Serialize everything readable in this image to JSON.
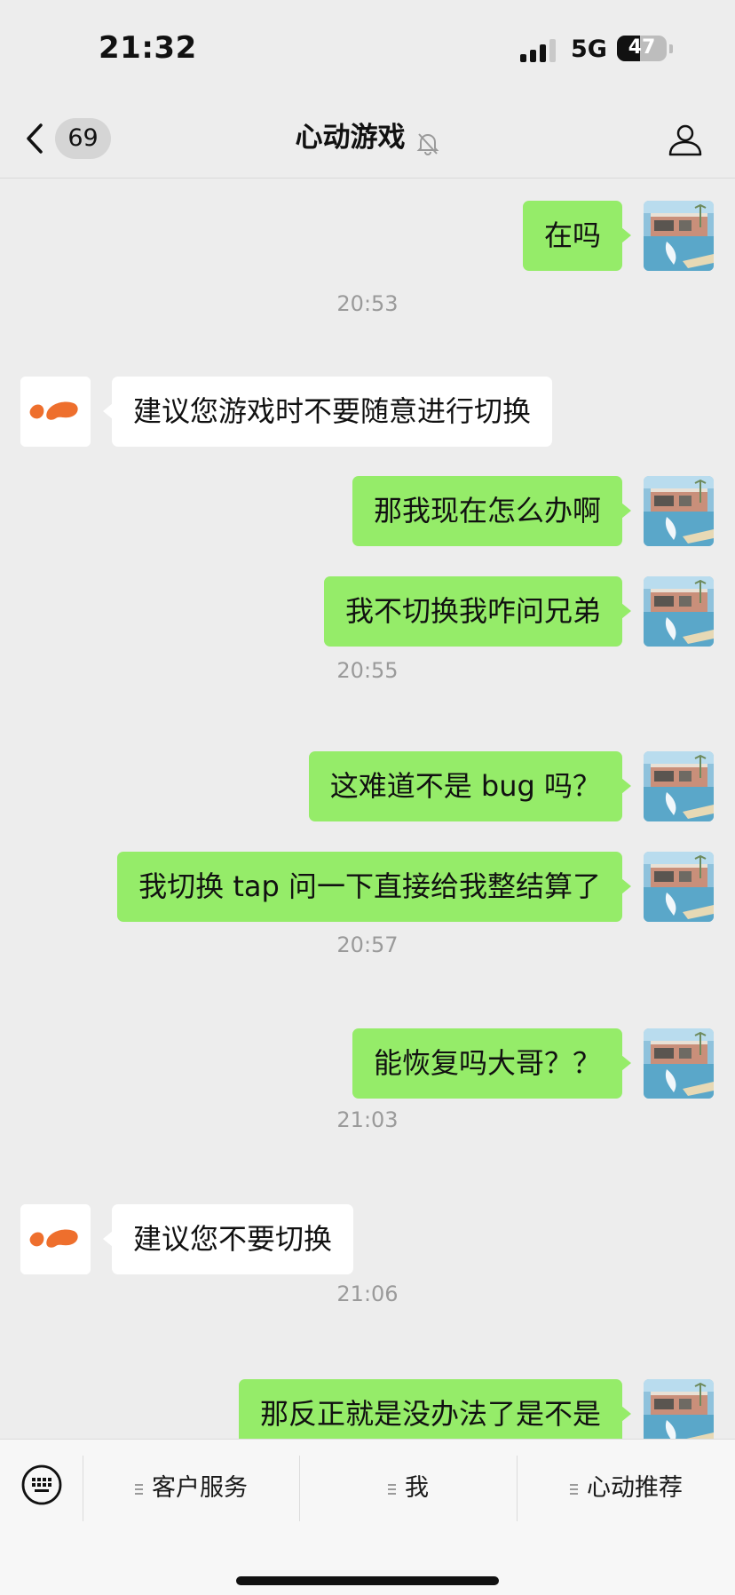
{
  "status_bar": {
    "time": "21:32",
    "network": "5G",
    "battery": "47",
    "battery_fill": 0.47
  },
  "nav": {
    "unread_count": "69",
    "title": "心动游戏"
  },
  "messages": [
    {
      "from": "me",
      "text": "在吗"
    },
    {
      "timestamp": "20:53"
    },
    {
      "from": "service",
      "text": "建议您游戏时不要随意进行切换"
    },
    {
      "from": "me",
      "text": "那我现在怎么办啊"
    },
    {
      "from": "me",
      "text": "我不切换我咋问兄弟"
    },
    {
      "timestamp": "20:55"
    },
    {
      "from": "me",
      "text": "这难道不是 bug 吗？"
    },
    {
      "from": "me",
      "text": "我切换 tap 问一下直接给我整结算了"
    },
    {
      "timestamp": "20:57"
    },
    {
      "from": "me",
      "text": "能恢复吗大哥？？"
    },
    {
      "timestamp": "21:03"
    },
    {
      "from": "service",
      "text": "建议您不要切换"
    },
    {
      "timestamp": "21:06"
    },
    {
      "from": "me",
      "text": "那反正就是没办法了是不是"
    }
  ],
  "menu": {
    "items": [
      "客户服务",
      "我",
      "心动推荐"
    ]
  },
  "colors": {
    "my_bubble": "#95ec69",
    "service_bubble": "#ffffff",
    "brand_orange": "#ee6f2d"
  }
}
